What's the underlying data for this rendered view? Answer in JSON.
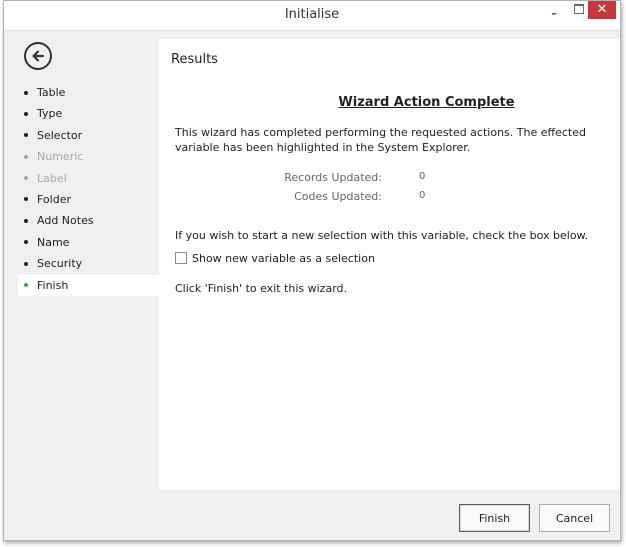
{
  "window": {
    "title": "Initialise",
    "minimize_glyph": "–",
    "close_glyph": "✕"
  },
  "sidebar": {
    "back_icon": "arrow-left-circle-icon",
    "items": [
      {
        "label": "Table",
        "state": "normal"
      },
      {
        "label": "Type",
        "state": "normal"
      },
      {
        "label": "Selector",
        "state": "normal"
      },
      {
        "label": "Numeric",
        "state": "disabled"
      },
      {
        "label": "Label",
        "state": "disabled"
      },
      {
        "label": "Folder",
        "state": "normal"
      },
      {
        "label": "Add Notes",
        "state": "normal"
      },
      {
        "label": "Name",
        "state": "normal"
      },
      {
        "label": "Security",
        "state": "normal"
      },
      {
        "label": "Finish",
        "state": "active"
      }
    ]
  },
  "main": {
    "section_title": "Results",
    "heading": "Wizard Action Complete",
    "description": "This wizard has completed performing the requested actions. The effected variable has been highlighted in the System Explorer.",
    "stats": [
      {
        "label": "Records Updated:",
        "value": "0"
      },
      {
        "label": "Codes Updated:",
        "value": "0"
      }
    ],
    "prompt": "If you wish to start a new selection with this variable, check the box below.",
    "checkbox_label": "Show new variable as a selection",
    "checkbox_checked": false,
    "exit_text": "Click 'Finish' to exit this wizard."
  },
  "footer": {
    "finish_label": "Finish",
    "cancel_label": "Cancel"
  },
  "colors": {
    "active_dot": "#4aa24a",
    "close_button": "#c7383d",
    "disabled_text": "#a8a8a8"
  }
}
